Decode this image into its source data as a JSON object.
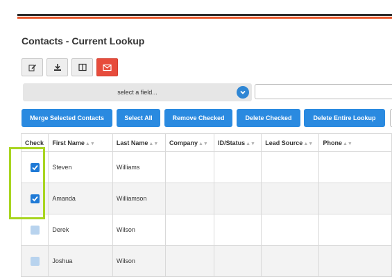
{
  "page": {
    "title": "Contacts - Current Lookup"
  },
  "toolbar": {
    "icons": [
      {
        "name": "edit-icon"
      },
      {
        "name": "download-icon"
      },
      {
        "name": "columns-icon"
      },
      {
        "name": "email-icon",
        "color": "#e74c3c"
      }
    ]
  },
  "filter": {
    "select_value": "select a field...",
    "input_value": ""
  },
  "actions": {
    "merge": "Merge Selected Contacts",
    "select_all": "Select All",
    "remove_checked": "Remove Checked",
    "delete_checked": "Delete Checked",
    "delete_entire": "Delete Entire Lookup"
  },
  "table": {
    "headers": [
      "Check",
      "First Name",
      "Last Name",
      "Company",
      "ID/Status",
      "Lead Source",
      "Phone"
    ],
    "sort_glyph": "▲▼",
    "rows": [
      {
        "checked": true,
        "first": "Steven",
        "last": "Williams",
        "company": "",
        "id_status": "",
        "lead_source": "",
        "phone": ""
      },
      {
        "checked": true,
        "first": "Amanda",
        "last": "Williamson",
        "company": "",
        "id_status": "",
        "lead_source": "",
        "phone": ""
      },
      {
        "checked": false,
        "first": "Derek",
        "last": "Wilson",
        "company": "",
        "id_status": "",
        "lead_source": "",
        "phone": ""
      },
      {
        "checked": false,
        "first": "Joshua",
        "last": "Wilson",
        "company": "",
        "id_status": "",
        "lead_source": "",
        "phone": ""
      }
    ]
  },
  "colors": {
    "accent": "#2a8ae0",
    "brand_orange": "#e8562a",
    "highlight": "#a8d520"
  }
}
